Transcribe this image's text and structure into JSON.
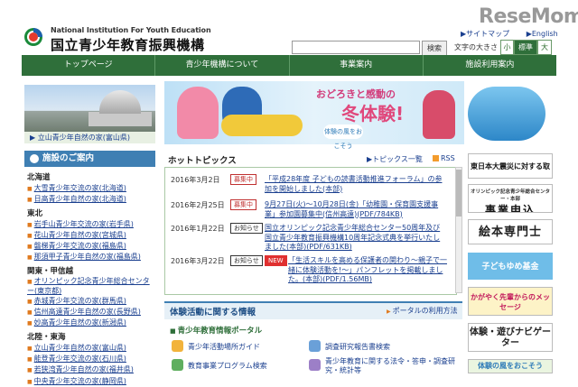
{
  "header": {
    "watermark": "ReseMom",
    "org_en": "National Institution For Youth Education",
    "org_jp": "国立青少年教育振興機構",
    "sitemap": "サイトマップ",
    "english": "English",
    "search_button": "検索",
    "font_size_label": "文字の大きさ",
    "font_sizes": [
      "小",
      "標準",
      "大"
    ]
  },
  "nav": [
    "トップページ",
    "青少年機構について",
    "事業案内",
    "施設利用案内"
  ],
  "left": {
    "photo_caption": "立山青少年自然の家(富山県)",
    "facility_heading": "施設のご案内",
    "groups": [
      {
        "region": "北海道",
        "items": [
          "大雪青少年交流の家(北海道)",
          "日高青少年自然の家(北海道)"
        ]
      },
      {
        "region": "東北",
        "items": [
          "岩手山青少年交流の家(岩手県)",
          "花山青少年自然の家(宮城県)",
          "磐梯青少年交流の家(福島県)",
          "那須甲子青少年自然の家(福島県)"
        ]
      },
      {
        "region": "関東・甲信越",
        "items": [
          "オリンピック記念青少年総合センター(東京都)",
          "赤城青少年交流の家(群馬県)",
          "信州高遠青少年自然の家(長野県)",
          "妙高青少年自然の家(新潟県)"
        ]
      },
      {
        "region": "北陸・東海",
        "items": [
          "立山青少年自然の家(富山県)",
          "能登青少年交流の家(石川県)",
          "若狭湾青少年自然の家(福井県)",
          "中央青少年交流の家(静岡県)"
        ]
      }
    ]
  },
  "banner": {
    "line1": "おどろきと感動の",
    "line2": "冬体験!",
    "sub": "体験の風をおこそう"
  },
  "topics": {
    "title": "ホットトピックス",
    "list_link": "トピックス一覧",
    "rss": "RSS",
    "items": [
      {
        "date": "2016年3月2日",
        "badge": "募集中",
        "text": "「平成28年度 子どもの読書活動推進フォーラム」の参加を開始しました(本部)"
      },
      {
        "date": "2016年2月25日",
        "badge": "募集中",
        "text": "9月27日(火)～10月28日(金)「幼稚園・保育園支援事業」参加園募集中(信州高遠)(PDF/784KB)"
      },
      {
        "date": "2016年1月22日",
        "badge": "お知らせ",
        "text": "国立オリンピック記念青少年総合センター50周年及び国立青少年教育振興機構10周年記念式典を挙行いたしました(本部)(PDF/631KB)"
      },
      {
        "date": "2016年3月22日",
        "badge": "お知らせ",
        "badge2": "NEW",
        "text": "「生活スキルを高める保護者の関わり～親子で一緒に体験活動を!～」パンフレットを掲載しました。(本部)(PDF/1.56MB)"
      }
    ]
  },
  "experience": {
    "title": "体験活動に関する情報",
    "portal_link": "ポータルの利用方法",
    "portal_title": "青少年教育情報ポータル",
    "links": [
      "青少年活動場所ガイド",
      "調査研究報告書検索",
      "教育事業プログラム検索",
      "青少年教育に関する法令・答申・調査研究・統計等"
    ]
  },
  "right_banners": [
    "東日本大震災に対する取組",
    "オリンピック記念青少年総合センター・本部",
    "事業申込",
    "絵本専門士",
    "子どもゆめ基金",
    "かがやく先輩からのメッセージ",
    "体験・遊びナビゲーター",
    "体験の風をおこそう"
  ]
}
